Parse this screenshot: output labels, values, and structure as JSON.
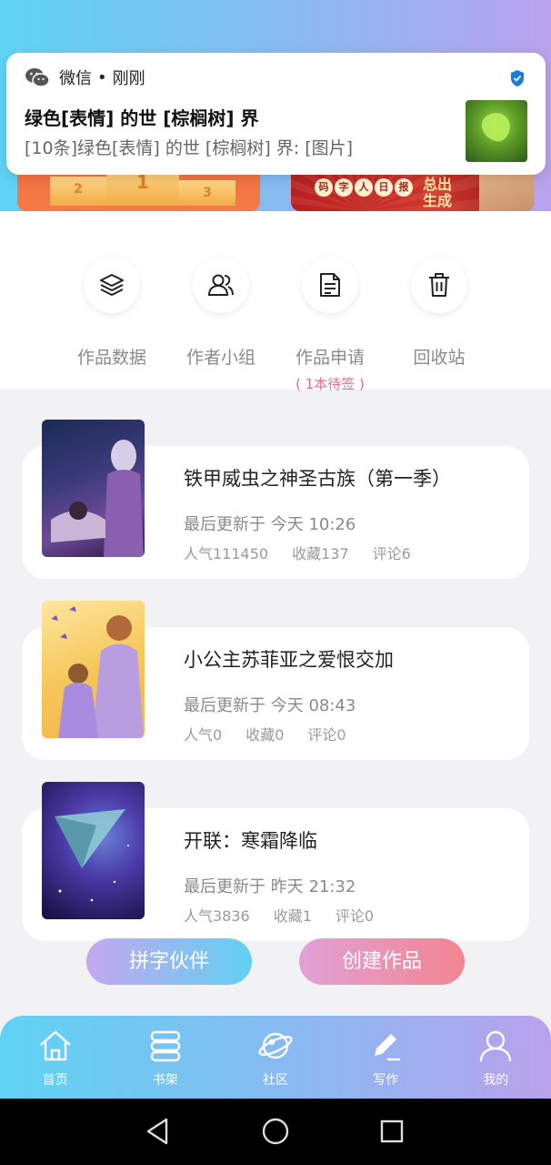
{
  "notification": {
    "app_name": "微信",
    "separator": "•",
    "time": "刚刚",
    "title": "绿色[表情] 的世 [棕榈树]  界",
    "body": "[10条]绿色[表情] 的世 [棕榈树]  界: [图片]"
  },
  "banners": {
    "right_pills": [
      "码",
      "字",
      "人",
      "日",
      "报"
    ],
    "right_text_1": "总出",
    "right_text_2": "生成",
    "podium": [
      "2",
      "1",
      "3"
    ]
  },
  "tools": [
    {
      "label": "作品数据",
      "icon": "layers-icon"
    },
    {
      "label": "作者小组",
      "icon": "users-icon"
    },
    {
      "label": "作品申请",
      "icon": "document-icon",
      "sub": "( 1本待签 )"
    },
    {
      "label": "回收站",
      "icon": "trash-icon"
    }
  ],
  "works": [
    {
      "title": "铁甲威虫之神圣古族（第一季）",
      "updated": "最后更新于 今天 10:26",
      "popularity": "人气111450",
      "favorites": "收藏137",
      "comments": "评论6"
    },
    {
      "title": "小公主苏菲亚之爱恨交加",
      "updated": "最后更新于 今天 08:43",
      "popularity": "人气0",
      "favorites": "收藏0",
      "comments": "评论0"
    },
    {
      "title": "开联：寒霜降临",
      "updated": "最后更新于 昨天 21:32",
      "popularity": "人气3836",
      "favorites": "收藏1",
      "comments": "评论0"
    }
  ],
  "actions": {
    "partner": "拼字伙伴",
    "create": "创建作品"
  },
  "nav": [
    {
      "label": "首页",
      "icon": "home-icon"
    },
    {
      "label": "书架",
      "icon": "bookshelf-icon"
    },
    {
      "label": "社区",
      "icon": "planet-icon"
    },
    {
      "label": "写作",
      "icon": "pen-icon"
    },
    {
      "label": "我的",
      "icon": "profile-icon"
    }
  ],
  "colors": {
    "gradient_start": "#5fd3f3",
    "gradient_end": "#b9a1ec",
    "accent_pink": "#e56b8a"
  }
}
